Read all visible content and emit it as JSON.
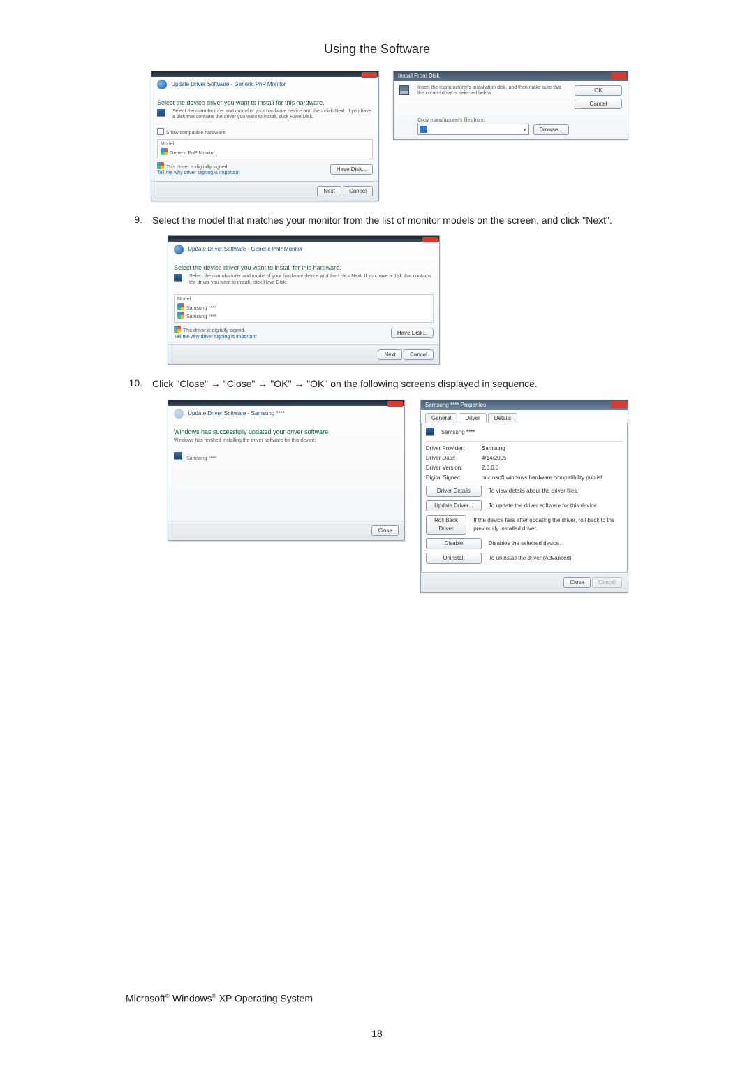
{
  "page": {
    "heading": "Using the Software",
    "number": "18"
  },
  "steps": {
    "s9": {
      "num": "9.",
      "text": "Select the model that matches your monitor from the list of monitor models on the screen, and click \"Next\"."
    },
    "s10": {
      "num": "10.",
      "text": "Click \"Close\" → \"Close\" → \"OK\" → \"OK\" on the following screens displayed in sequence."
    }
  },
  "win_select1": {
    "crumb": "Update Driver Software - Generic PnP Monitor",
    "title": "Select the device driver you want to install for this hardware.",
    "desc": "Select the manufacturer and model of your hardware device and then click Next. If you have a disk that contains the driver you want to install, click Have Disk.",
    "checkbox": "Show compatible hardware",
    "model_hdr": "Model",
    "model1": "Generic PnP Monitor",
    "signed": "This driver is digitally signed.",
    "tell": "Tell me why driver signing is important",
    "havedisk": "Have Disk...",
    "next": "Next",
    "cancel": "Cancel"
  },
  "win_disk": {
    "title": "Install From Disk",
    "msg": "Insert the manufacturer's installation disk, and then make sure that the correct drive is selected below.",
    "copy": "Copy manufacturer's files from:",
    "ok": "OK",
    "cancel": "Cancel",
    "browse": "Browse..."
  },
  "win_select2": {
    "crumb": "Update Driver Software - Generic PnP Monitor",
    "title": "Select the device driver you want to install for this hardware.",
    "desc": "Select the manufacturer and model of your hardware device and then click Next. If you have a disk that contains the driver you want to install, click Have Disk.",
    "model_hdr": "Model",
    "model1": "Samsung ****",
    "model2": "Samsung ****",
    "signed": "This driver is digitally signed.",
    "tell": "Tell me why driver signing is important",
    "havedisk": "Have Disk...",
    "next": "Next",
    "cancel": "Cancel"
  },
  "win_done": {
    "crumb": "Update Driver Software - Samsung ****",
    "title": "Windows has successfully updated your driver software",
    "sub": "Windows has finished installing the driver software for this device:",
    "model": "Samsung ****",
    "close": "Close"
  },
  "win_props": {
    "wintitle": "Samsung **** Properties",
    "tab_general": "General",
    "tab_driver": "Driver",
    "tab_details": "Details",
    "device": "Samsung ****",
    "provider_l": "Driver Provider:",
    "provider_v": "Samsung",
    "date_l": "Driver Date:",
    "date_v": "4/14/2005",
    "version_l": "Driver Version:",
    "version_v": "2.0.0.0",
    "signer_l": "Digital Signer:",
    "signer_v": "microsoft windows hardware compatibility publisl",
    "b_details": "Driver Details",
    "d_details": "To view details about the driver files.",
    "b_update": "Update Driver...",
    "d_update": "To update the driver software for this device.",
    "b_roll": "Roll Back Driver",
    "d_roll": "If the device fails after updating the driver, roll back to the previously installed driver.",
    "b_disable": "Disable",
    "d_disable": "Disables the selected device.",
    "b_uninstall": "Uninstall",
    "d_uninstall": "To uninstall the driver (Advanced).",
    "close": "Close",
    "cancel": "Cancel"
  },
  "footer": {
    "os_pre": "Microsoft",
    "os_mid": " Windows",
    "os_post": " XP Operating System",
    "reg": "®"
  }
}
